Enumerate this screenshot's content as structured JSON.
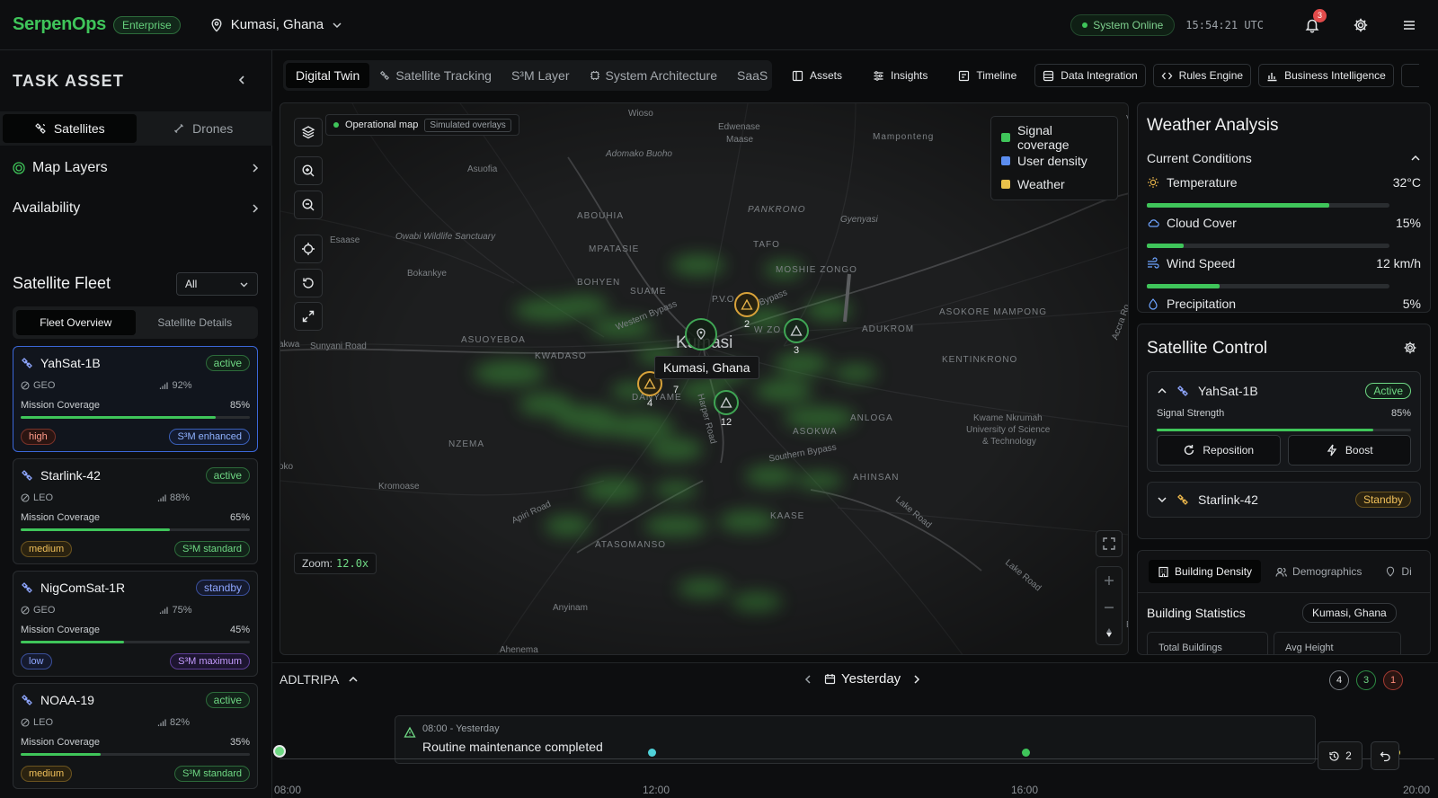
{
  "app": {
    "logo": "SerpenOps",
    "edition": "Enterprise",
    "location": "Kumasi, Ghana"
  },
  "status": {
    "system": "System Online",
    "clock": "15:54:21 UTC",
    "notifications": "3"
  },
  "sidebar": {
    "title": "TASK ASSET",
    "segments": [
      "Satellites",
      "Drones"
    ],
    "rows": [
      "Map Layers",
      "Availability"
    ],
    "fleet_title": "Satellite Fleet",
    "filter_value": "All",
    "fleet_tabs": [
      "Fleet Overview",
      "Satellite Details"
    ],
    "cards": [
      {
        "name": "YahSat-1B",
        "status": "active",
        "orbit": "GEO",
        "signal": "92%",
        "coverage_label": "Mission Coverage",
        "coverage": "85%",
        "coverage_frac": 0.85,
        "priority": "high",
        "mode": "S³M enhanced"
      },
      {
        "name": "Starlink-42",
        "status": "active",
        "orbit": "LEO",
        "signal": "88%",
        "coverage_label": "Mission Coverage",
        "coverage": "65%",
        "coverage_frac": 0.65,
        "priority": "medium",
        "mode": "S³M standard"
      },
      {
        "name": "NigComSat-1R",
        "status": "standby",
        "orbit": "GEO",
        "signal": "75%",
        "coverage_label": "Mission Coverage",
        "coverage": "45%",
        "coverage_frac": 0.45,
        "priority": "low",
        "mode": "S³M maximum"
      },
      {
        "name": "NOAA-19",
        "status": "active",
        "orbit": "LEO",
        "signal": "82%",
        "coverage_label": "Mission Coverage",
        "coverage": "35%",
        "coverage_frac": 0.35,
        "priority": "medium",
        "mode": "S³M standard"
      }
    ]
  },
  "nav": {
    "tabs": [
      "Digital Twin",
      "Satellite Tracking",
      "S³M Layer",
      "System Architecture",
      "SaaS"
    ],
    "buttons": [
      "Assets",
      "Insights",
      "Timeline",
      "Data Integration",
      "Rules Engine",
      "Business Intelligence"
    ]
  },
  "map": {
    "op_label": "Operational map",
    "sim_label": "Simulated overlays",
    "legend": [
      {
        "label": "Signal coverage",
        "color": "#3fc55a"
      },
      {
        "label": "User density",
        "color": "#5b8def"
      },
      {
        "label": "Weather",
        "color": "#e8c04a"
      }
    ],
    "zoom_label": "Zoom:",
    "zoom_value": "12.0x",
    "tooltip": "Kumasi, Ghana",
    "markers": [
      "2",
      "3",
      "7",
      "4",
      "12"
    ],
    "places": [
      "Wioso",
      "Edwenase",
      "Maase",
      "Mamponteng",
      "Adomako Buoho",
      "Asuofia",
      "ABOUHIA",
      "PANKRONO",
      "Gyenyasi",
      "Esaase",
      "Owabi Wildlife Sanctuary",
      "MPATASIE",
      "TAFO",
      "Bokankye",
      "BOHYEN",
      "SUAME",
      "MOSHIE ZONGO",
      "P.V.O",
      "Bypass",
      "Western Bypass",
      "ASOKORE MAMPONG",
      "akwa",
      "Sunyani Road",
      "ASUOYEBOA",
      "KWADASO",
      "W ZO",
      "ADUKROM",
      "Accra Ro",
      "KENTINKRONO",
      "DANYAME",
      "Harper Road",
      "ANLOGA",
      "NZEMA",
      "ASOKWA",
      "Kwame Nkrumah",
      "University of Science",
      "& Technology",
      "Southern Bypass",
      "oko",
      "AHINSAN",
      "Kromoase",
      "Apiri Road",
      "KAASE",
      "Lake Road",
      "ATASOMANSO",
      "Anyinam",
      "Ahenema",
      "Lake Road",
      "Von",
      "Kumasi",
      "a",
      "Es"
    ]
  },
  "weather": {
    "title": "Weather Analysis",
    "section": "Current Conditions",
    "rows": [
      {
        "label": "Temperature",
        "value": "32°C",
        "frac": 0.75
      },
      {
        "label": "Cloud Cover",
        "value": "15%",
        "frac": 0.15
      },
      {
        "label": "Wind Speed",
        "value": "12 km/h",
        "frac": 0.3
      },
      {
        "label": "Precipitation",
        "value": "5%",
        "frac": 0.05
      }
    ]
  },
  "satcontrol": {
    "title": "Satellite Control",
    "items": [
      {
        "name": "YahSat-1B",
        "status": "Active",
        "signal_label": "Signal Strength",
        "signal": "85%",
        "signal_frac": 0.85
      },
      {
        "name": "Starlink-42",
        "status": "Standby"
      }
    ],
    "actions": [
      "Reposition",
      "Boost"
    ]
  },
  "building": {
    "tabs": [
      "Building Density",
      "Demographics",
      "Di"
    ],
    "title": "Building Statistics",
    "location": "Kumasi, Ghana",
    "stats": [
      "Total Buildings",
      "Avg Height"
    ]
  },
  "timeline": {
    "title": "ADLTRIPA",
    "date": "Yesterday",
    "counts": [
      "4",
      "3",
      "1"
    ],
    "event_time": "08:00 - Yesterday",
    "event_text": "Routine maintenance completed",
    "ticks": [
      "08:00",
      "12:00",
      "16:00",
      "20:00"
    ],
    "history_count": "2"
  }
}
